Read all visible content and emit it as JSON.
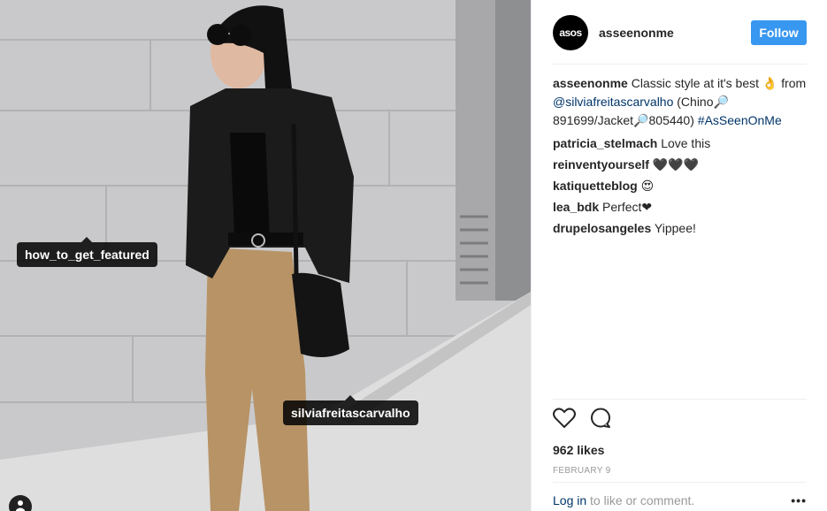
{
  "post": {
    "author": "asseenonme",
    "avatar_text": "asos",
    "follow_label": "Follow",
    "tags": [
      "how_to_get_featured",
      "silviafreitascarvalho"
    ]
  },
  "caption": {
    "user": "asseenonme",
    "text_1": "Classic style at it's best 👌 from ",
    "mention": "@silviafreitascarvalho",
    "text_2": " (Chino🔎 891699/Jacket🔎805440) ",
    "hashtag": "#AsSeenOnMe"
  },
  "comments": [
    {
      "user": "patricia_stelmach",
      "text": "Love this"
    },
    {
      "user": "reinventyourself",
      "text": "🖤🖤🖤"
    },
    {
      "user": "katiquetteblog",
      "text": "😍"
    },
    {
      "user": "lea_bdk",
      "text": "Perfect❤"
    },
    {
      "user": "drupelosangeles",
      "text": "Yippee!"
    }
  ],
  "stats": {
    "likes": "962 likes",
    "date": "FEBRUARY 9"
  },
  "footer": {
    "login": "Log in",
    "rest": " to like or comment.",
    "more": "•••"
  },
  "colors": {
    "accent": "#3897f0",
    "link": "#003569",
    "muted": "#999999"
  },
  "icons": [
    "heart-icon",
    "comment-icon",
    "user-tag-icon"
  ]
}
